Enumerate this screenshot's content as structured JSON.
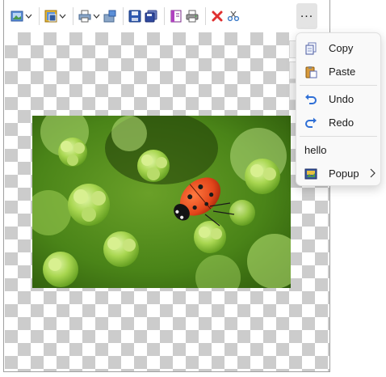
{
  "toolbar": {
    "buttons": [
      {
        "name": "image-icon"
      },
      {
        "name": "picture-frame-icon"
      },
      {
        "name": "print-options-icon"
      },
      {
        "name": "export-icon"
      },
      {
        "name": "save-icon"
      },
      {
        "name": "save-all-icon"
      },
      {
        "name": "book-icon"
      },
      {
        "name": "print-icon"
      },
      {
        "name": "delete-icon"
      },
      {
        "name": "scissors-icon"
      }
    ],
    "more_label": "..."
  },
  "menu": {
    "items": [
      {
        "label": "Copy",
        "icon": "copy-icon"
      },
      {
        "label": "Paste",
        "icon": "paste-icon"
      },
      {
        "label": "Undo",
        "icon": "undo-icon"
      },
      {
        "label": "Redo",
        "icon": "redo-icon"
      },
      {
        "label": "hello"
      },
      {
        "label": "Popup",
        "icon": "popup-image-icon"
      }
    ]
  },
  "colors": {
    "accent_blue": "#2f6fd6",
    "delete_red": "#e03030",
    "checker": "#cccccc"
  }
}
